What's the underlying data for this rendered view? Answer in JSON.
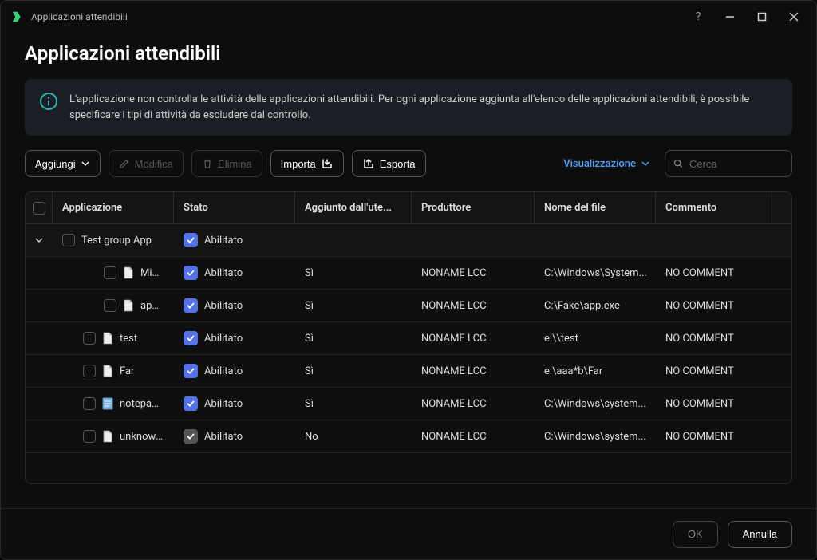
{
  "titlebar": {
    "title": "Applicazioni attendibili"
  },
  "page_title": "Applicazioni attendibili",
  "info": {
    "text": "L'applicazione non controlla le attività delle applicazioni attendibili. Per ogni applicazione aggiunta all'elenco delle applicazioni attendibili, è possibile specificare i tipi di attività da escludere dal controllo."
  },
  "toolbar": {
    "add": "Aggiungi",
    "edit": "Modifica",
    "delete": "Elimina",
    "import": "Importa",
    "export": "Esporta",
    "view": "Visualizzazione",
    "search_placeholder": "Cerca"
  },
  "columns": {
    "app": "Applicazione",
    "state": "Stato",
    "added": "Aggiunto dall'ute...",
    "producer": "Produttore",
    "filename": "Nome del file",
    "comment": "Commento"
  },
  "group": {
    "name": "Test group App",
    "state": "Abilitato"
  },
  "rows": [
    {
      "indent": 2,
      "app": "Micros...",
      "state": "Abilitato",
      "enabled": true,
      "added": "Sì",
      "producer": "NONAME LCC",
      "file": "C:\\Windows\\System...",
      "comment": "NO COMMENT",
      "icon": "doc"
    },
    {
      "indent": 2,
      "app": "app.exe",
      "state": "Abilitato",
      "enabled": true,
      "added": "Sì",
      "producer": "NONAME LCC",
      "file": "C:\\Fake\\app.exe",
      "comment": "NO COMMENT",
      "icon": "doc"
    },
    {
      "indent": 1,
      "app": "test",
      "state": "Abilitato",
      "enabled": true,
      "added": "Sì",
      "producer": "NONAME LCC",
      "file": "e:\\\\test",
      "comment": "NO COMMENT",
      "icon": "doc"
    },
    {
      "indent": 1,
      "app": "Far",
      "state": "Abilitato",
      "enabled": true,
      "added": "Sì",
      "producer": "NONAME LCC",
      "file": "e:\\aaa*b\\Far",
      "comment": "NO COMMENT",
      "icon": "doc"
    },
    {
      "indent": 1,
      "app": "notepad.e...",
      "state": "Abilitato",
      "enabled": true,
      "added": "Sì",
      "producer": "NONAME LCC",
      "file": "C:\\Windows\\system...",
      "comment": "NO COMMENT",
      "icon": "notepad"
    },
    {
      "indent": 1,
      "app": "unknown....",
      "state": "Abilitato",
      "enabled": false,
      "added": "No",
      "producer": "NONAME LCC",
      "file": "C:\\Windows\\system...",
      "comment": "NO COMMENT",
      "icon": "doc"
    }
  ],
  "footer": {
    "ok": "OK",
    "cancel": "Annulla"
  }
}
